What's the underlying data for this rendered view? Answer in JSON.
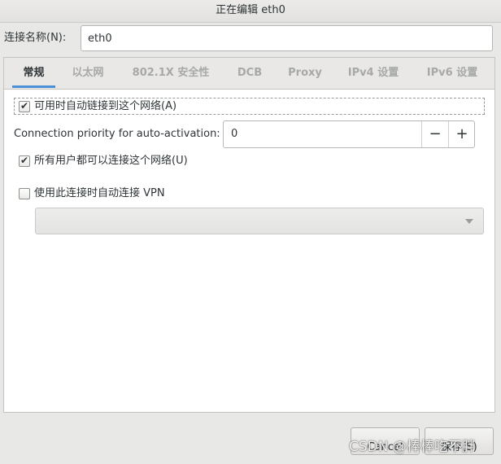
{
  "window": {
    "title": "正在编辑 eth0"
  },
  "connection_name": {
    "label": "连接名称(N):",
    "value": "eth0"
  },
  "tabs": [
    {
      "label": "常规",
      "active": true
    },
    {
      "label": "以太网",
      "active": false
    },
    {
      "label": "802.1X 安全性",
      "active": false
    },
    {
      "label": "DCB",
      "active": false
    },
    {
      "label": "Proxy",
      "active": false
    },
    {
      "label": "IPv4 设置",
      "active": false
    },
    {
      "label": "IPv6 设置",
      "active": false
    }
  ],
  "general": {
    "auto_connect": {
      "label": "可用时自动链接到这个网络(A)",
      "checked": true
    },
    "priority": {
      "label": "Connection priority for auto-activation:",
      "value": "0",
      "minus": "−",
      "plus": "+"
    },
    "all_users": {
      "label": "所有用户都可以连接这个网络(U)",
      "checked": true
    },
    "auto_vpn": {
      "label": "使用此连接时自动连接 VPN",
      "checked": false
    },
    "vpn_select": {
      "value": ""
    }
  },
  "buttons": {
    "cancel": "Cancel",
    "save": "保存(S)"
  },
  "watermark": "CSDN @棒棒吃不胖",
  "colors": {
    "accent": "#4a90d9",
    "background": "#e8e8e7",
    "panel": "#ffffff"
  },
  "icons": {
    "check": "check-icon",
    "dropdown": "chevron-down-icon"
  }
}
